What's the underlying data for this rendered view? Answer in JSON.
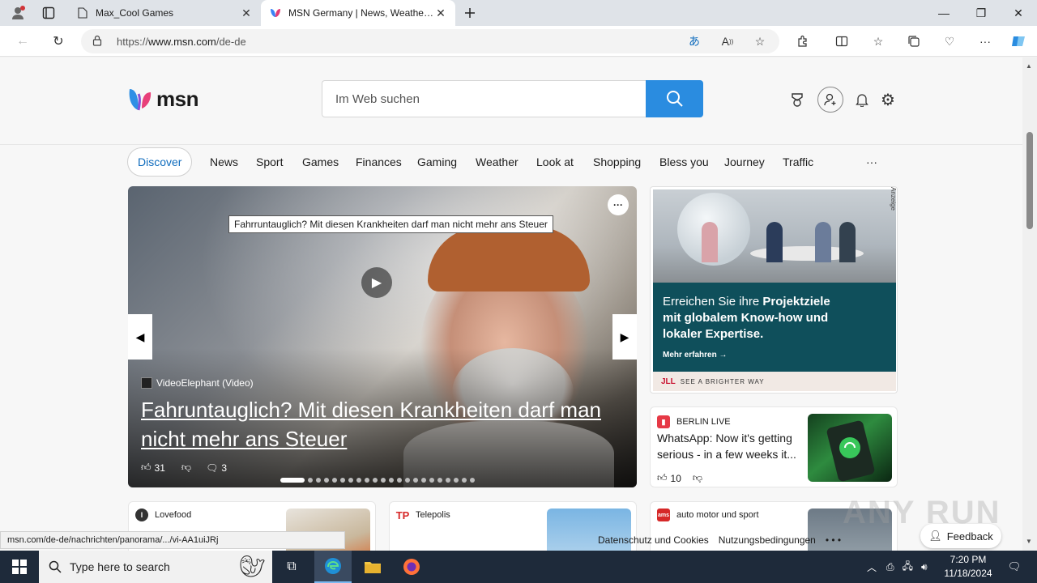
{
  "browser": {
    "tabs": [
      {
        "title": "Max_Cool Games",
        "icon": "page-icon"
      },
      {
        "title": "MSN Germany | News, Weather, S",
        "icon": "msn-butterfly-icon"
      }
    ],
    "url_prefix": "https://",
    "url_host": "www.msn.com",
    "url_path": "/de-de",
    "status_url": "msn.com/de-de/nachrichten/panorama/.../vi-AA1uiJRj"
  },
  "msn": {
    "logo_text": "msn",
    "search_placeholder": "Im Web suchen",
    "categories": [
      "Discover",
      "News",
      "Sport",
      "Games",
      "Finances",
      "Gaming",
      "Weather",
      "Look at",
      "Shopping",
      "Bless you",
      "Journey",
      "Traffic"
    ],
    "more_label": "···",
    "hero": {
      "tooltip": "Fahrruntauglich? Mit diesen Krankheiten darf man nicht mehr ans Steuer",
      "source": "VideoElephant (Video)",
      "headline": "Fahruntauglich? Mit diesen Krankheiten darf man nicht mehr ans Steuer",
      "likes": "31",
      "comments": "3",
      "slide_count": 22,
      "active_slide": 0
    },
    "ad": {
      "line1_normal": "Erreichen Sie ihre ",
      "line1_bold": "Projektziele",
      "line2": "mit globalem Know-how und",
      "line3": "lokaler Expertise.",
      "cta": "Mehr erfahren →",
      "brand": "JLL",
      "tagline": "SEE A BRIGHTER WAY",
      "badge": "Anzeige"
    },
    "news_card": {
      "source": "BERLIN LIVE",
      "title": "WhatsApp: Now it's getting serious - in a few weeks it...",
      "likes": "10"
    },
    "bottom_cards": [
      {
        "source": "Lovefood"
      },
      {
        "source": "Telepolis"
      },
      {
        "source": "auto motor und sport"
      }
    ],
    "footer": {
      "privacy": "Datenschutz und Cookies",
      "terms": "Nutzungsbedingungen",
      "more": "• • •",
      "feedback": "Feedback"
    }
  },
  "taskbar": {
    "search_placeholder": "Type here to search",
    "time": "7:20 PM",
    "date": "11/18/2024"
  },
  "watermark": "ANY RUN",
  "colors": {
    "accent": "#2a8ce0",
    "ad_panel": "#0f4f5b",
    "taskbar": "#1e2a3a"
  }
}
